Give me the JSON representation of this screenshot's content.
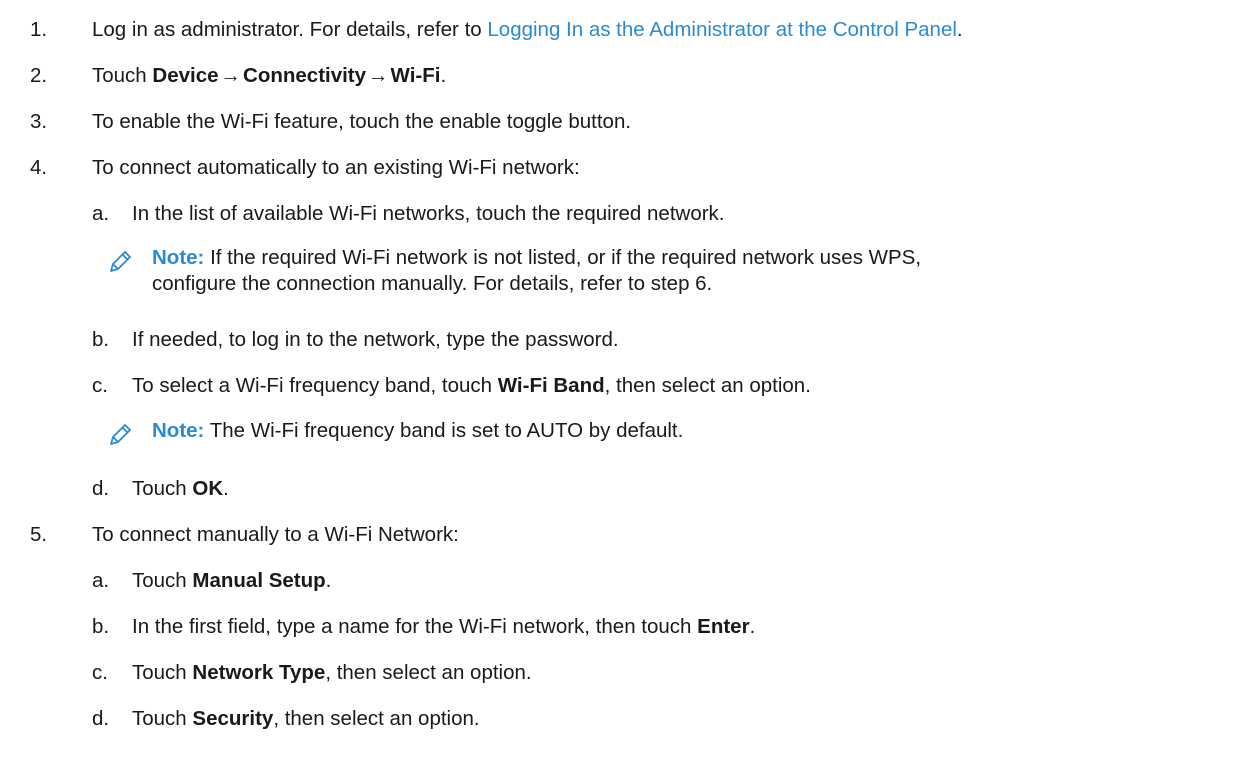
{
  "colors": {
    "link": "#2a8bd4",
    "note_label": "#2a8bd4",
    "text": "#1a1a1a"
  },
  "steps": [
    {
      "number": "1.",
      "text_before": "Log in as administrator. For details, refer to ",
      "link": "Logging In as the Administrator at the Control Panel",
      "text_after": "."
    },
    {
      "number": "2.",
      "text_before": "Touch ",
      "bold1": "Device",
      "arrow1": "→",
      "bold2": "Connectivity",
      "arrow2": "→",
      "bold3": "Wi-Fi",
      "text_after": "."
    },
    {
      "number": "3.",
      "text": "To enable the Wi-Fi feature, touch the enable toggle button."
    },
    {
      "number": "4.",
      "text": "To connect automatically to an existing Wi-Fi network:",
      "substeps": [
        {
          "letter": "a.",
          "text": "In the list of available Wi-Fi networks, touch the required network.",
          "note": {
            "icon": "pencil-icon",
            "label": "Note:",
            "line1": " If the required Wi-Fi network is not listed, or if the required network uses WPS,",
            "line2": "configure the connection manually. For details, refer to step 6."
          }
        },
        {
          "letter": "b.",
          "text": "If needed, to log in to the network, type the password."
        },
        {
          "letter": "c.",
          "text_before": "To select a Wi-Fi frequency band, touch ",
          "bold": "Wi-Fi Band",
          "text_after": ", then select an option.",
          "note": {
            "icon": "pencil-icon",
            "label": "Note:",
            "line1": " The Wi-Fi frequency band is set to AUTO by default."
          }
        },
        {
          "letter": "d.",
          "text_before": "Touch ",
          "bold": "OK",
          "text_after": "."
        }
      ]
    },
    {
      "number": "5.",
      "text": "To connect manually to a Wi-Fi Network:",
      "substeps": [
        {
          "letter": "a.",
          "text_before": "Touch ",
          "bold": "Manual Setup",
          "text_after": "."
        },
        {
          "letter": "b.",
          "text_before": "In the first field, type a name for the Wi-Fi network, then touch ",
          "bold": "Enter",
          "text_after": "."
        },
        {
          "letter": "c.",
          "text_before": "Touch ",
          "bold": "Network Type",
          "text_after": ", then select an option."
        },
        {
          "letter": "d.",
          "text_before": "Touch ",
          "bold": "Security",
          "text_after": ", then select an option."
        }
      ]
    }
  ]
}
